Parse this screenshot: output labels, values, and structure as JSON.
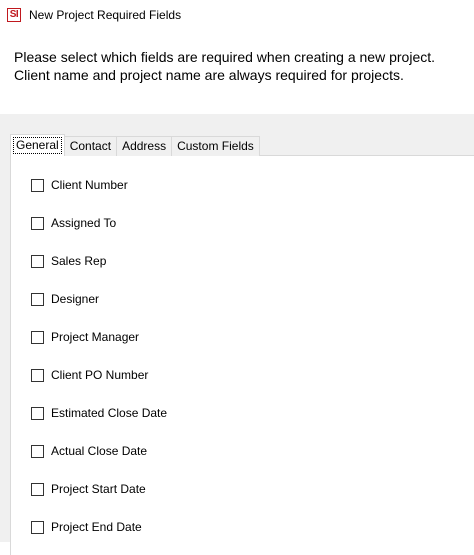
{
  "window": {
    "icon_text": "SI",
    "title": "New Project Required Fields"
  },
  "instructions": {
    "line1": "Please select which fields are required when creating a new project.",
    "line2": "Client name and project name are always required for projects."
  },
  "tabs": [
    {
      "label": "General",
      "selected": true
    },
    {
      "label": "Contact",
      "selected": false
    },
    {
      "label": "Address",
      "selected": false
    },
    {
      "label": "Custom Fields",
      "selected": false
    }
  ],
  "fields": [
    {
      "label": "Client Number",
      "checked": false
    },
    {
      "label": "Assigned To",
      "checked": false
    },
    {
      "label": "Sales Rep",
      "checked": false
    },
    {
      "label": "Designer",
      "checked": false
    },
    {
      "label": "Project Manager",
      "checked": false
    },
    {
      "label": "Client PO Number",
      "checked": false
    },
    {
      "label": "Estimated Close Date",
      "checked": false
    },
    {
      "label": "Actual Close Date",
      "checked": false
    },
    {
      "label": "Project Start Date",
      "checked": false
    },
    {
      "label": "Project End Date",
      "checked": false
    }
  ]
}
